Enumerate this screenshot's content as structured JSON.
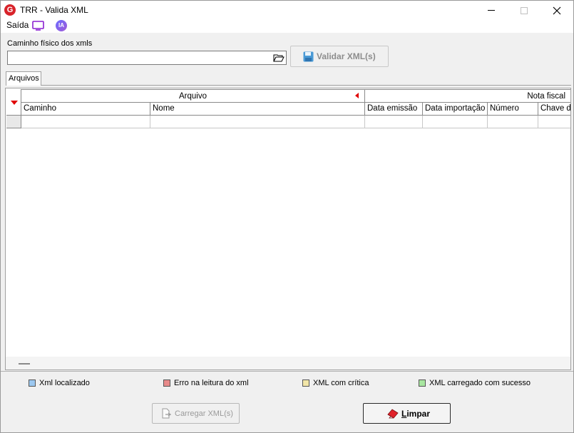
{
  "window": {
    "title": "TRR - Valida XML",
    "logo_letter": "G"
  },
  "menu": {
    "saida_label": "Saída",
    "ia_label": "IA"
  },
  "form": {
    "path_label": "Caminho físico dos xmls",
    "path_value": "",
    "validate_button": "Validar XML(s)"
  },
  "tabs": [
    {
      "label": "Arquivos"
    }
  ],
  "grid": {
    "groups": {
      "arquivo": "Arquivo",
      "nota_fiscal": "Nota fiscal"
    },
    "columns": [
      "Caminho",
      "Nome",
      "Data emissão",
      "Data importação",
      "Número",
      "Chave d"
    ]
  },
  "legend": [
    {
      "label": "Xml localizado",
      "color": "#9cc8f0"
    },
    {
      "label": "Erro na leitura do xml",
      "color": "#e88a8a"
    },
    {
      "label": "XML com crítica",
      "color": "#f2e6a8"
    },
    {
      "label": "XML carregado com sucesso",
      "color": "#a8e6a0"
    }
  ],
  "buttons": {
    "load": "Carregar XML(s)",
    "clear": "Limpar"
  }
}
